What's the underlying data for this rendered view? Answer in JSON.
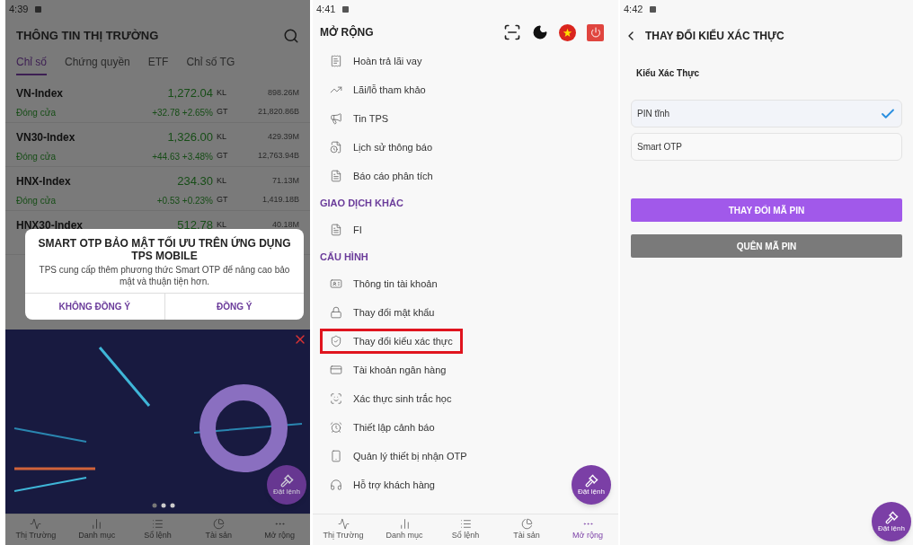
{
  "market_screen": {
    "status_time": "4:39",
    "title": "THÔNG TIN THỊ TRƯỜNG",
    "tabs": [
      {
        "label": "Chỉ số",
        "selected": true
      },
      {
        "label": "Chứng quyền",
        "selected": false
      },
      {
        "label": "ETF",
        "selected": false
      },
      {
        "label": "Chỉ số TG",
        "selected": false
      }
    ],
    "rows": [
      {
        "name": "VN-Index",
        "price": "1,272.04",
        "vol_label": "KL",
        "volume": "898.26M",
        "status": "Đóng cửa",
        "change": "+32.78 +2.65%",
        "val_label": "GT",
        "value": "21,820.86B"
      },
      {
        "name": "VN30-Index",
        "price": "1,326.00",
        "vol_label": "KL",
        "volume": "429.39M",
        "status": "Đóng cửa",
        "change": "+44.63 +3.48%",
        "val_label": "GT",
        "value": "12,763.94B"
      },
      {
        "name": "HNX-Index",
        "price": "234.30",
        "vol_label": "KL",
        "volume": "71.13M",
        "status": "Đóng cửa",
        "change": "+0.53 +0.23%",
        "val_label": "GT",
        "value": "1,419.18B"
      },
      {
        "name": "HNX30-Index",
        "price": "512.78",
        "vol_label": "KL",
        "volume": "40.18M"
      }
    ],
    "dialog": {
      "title": "SMART OTP BẢO MẬT TỐI ƯU TRÊN ỨNG DỤNG TPS MOBILE",
      "message": "TPS cung cấp thêm phương thức Smart OTP để nâng cao bảo mật và thuận tiện hơn.",
      "buttons": [
        "KHÔNG ĐỒNG Ý",
        "ĐỒNG Ý"
      ]
    },
    "fab_label": "Đặt lệnh",
    "nav": [
      {
        "label": "Thị Trường",
        "selected": false
      },
      {
        "label": "Danh mục",
        "selected": false
      },
      {
        "label": "Sổ lệnh",
        "selected": false
      },
      {
        "label": "Tài sản",
        "selected": false
      },
      {
        "label": "Mở rộng",
        "selected": false
      }
    ]
  },
  "menu_screen": {
    "status_time": "4:41",
    "title": "MỞ RỘNG",
    "sections": [
      {
        "items": [
          {
            "label": "Hoàn trả lãi vay",
            "highlighted": false
          },
          {
            "label": "Lãi/lỗ tham khảo",
            "highlighted": false
          },
          {
            "label": "Tin TPS",
            "highlighted": false
          },
          {
            "label": "Lịch sử thông báo",
            "highlighted": false
          },
          {
            "label": "Báo cáo phân tích",
            "highlighted": false
          }
        ]
      },
      {
        "title": "GIAO DỊCH KHÁC",
        "items": [
          {
            "label": "FI",
            "highlighted": false
          }
        ]
      },
      {
        "title": "CẤU HÌNH",
        "items": [
          {
            "label": "Thông tin tài khoản",
            "highlighted": false
          },
          {
            "label": "Thay đổi mật khẩu",
            "highlighted": false
          },
          {
            "label": "Thay đổi kiểu xác thực",
            "highlighted": true
          },
          {
            "label": "Tài khoản ngân hàng",
            "highlighted": false
          },
          {
            "label": "Xác thực sinh trắc học",
            "highlighted": false
          },
          {
            "label": "Thiết lập cảnh báo",
            "highlighted": false
          },
          {
            "label": "Quản lý thiết bị nhận OTP",
            "highlighted": false
          },
          {
            "label": "Hỗ trợ khách hàng",
            "highlighted": false
          }
        ]
      }
    ],
    "fab_label": "Đặt lệnh",
    "nav": [
      {
        "label": "Thị Trường",
        "selected": false
      },
      {
        "label": "Danh mục",
        "selected": false
      },
      {
        "label": "Sổ lệnh",
        "selected": false
      },
      {
        "label": "Tài sản",
        "selected": false
      },
      {
        "label": "Mở rộng",
        "selected": true
      }
    ]
  },
  "auth_screen": {
    "status_time": "4:42",
    "title": "THAY ĐỔI KIỂU XÁC THỰC",
    "field_label": "Kiểu Xác Thực",
    "options": [
      {
        "label": "PIN tĩnh",
        "selected": true
      },
      {
        "label": "Smart OTP",
        "selected": false
      }
    ],
    "primary_button": "THAY ĐỔI MÃ PIN",
    "secondary_button": "QUÊN MÃ PIN",
    "fab_label": "Đặt lệnh"
  }
}
